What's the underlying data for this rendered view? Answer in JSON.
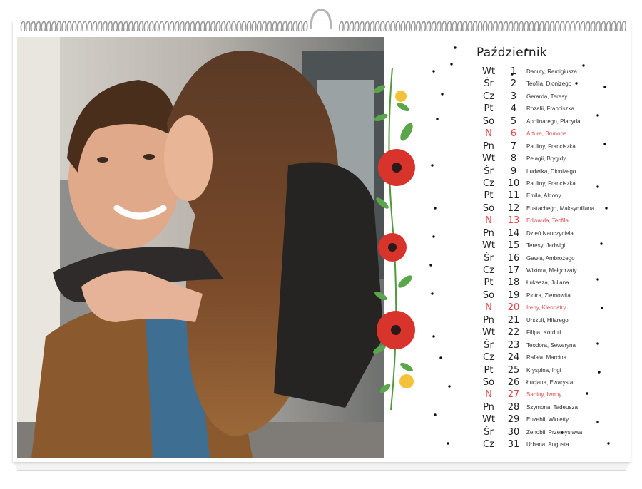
{
  "calendar": {
    "month": "Październik",
    "days": [
      {
        "dn": "Wt",
        "num": "1",
        "names": "Danuty, Remigiusza",
        "holiday": false
      },
      {
        "dn": "Śr",
        "num": "2",
        "names": "Teofila, Dionizego",
        "holiday": false
      },
      {
        "dn": "Cz",
        "num": "3",
        "names": "Gerarda, Teresy",
        "holiday": false
      },
      {
        "dn": "Pt",
        "num": "4",
        "names": "Rozalii, Franciszka",
        "holiday": false
      },
      {
        "dn": "So",
        "num": "5",
        "names": "Apolinarego, Placyda",
        "holiday": false
      },
      {
        "dn": "N",
        "num": "6",
        "names": "Artura, Brunona",
        "holiday": true
      },
      {
        "dn": "Pn",
        "num": "7",
        "names": "Pauliny, Franciszka",
        "holiday": false
      },
      {
        "dn": "Wt",
        "num": "8",
        "names": "Pelagii, Brygidy",
        "holiday": false
      },
      {
        "dn": "Śr",
        "num": "9",
        "names": "Ludwika, Dionizego",
        "holiday": false
      },
      {
        "dn": "Cz",
        "num": "10",
        "names": "Pauliny, Franciszka",
        "holiday": false
      },
      {
        "dn": "Pt",
        "num": "11",
        "names": "Emila, Aldony",
        "holiday": false
      },
      {
        "dn": "So",
        "num": "12",
        "names": "Eustachego, Maksymiliana",
        "holiday": false
      },
      {
        "dn": "N",
        "num": "13",
        "names": "Edwarda, Teofila",
        "holiday": true
      },
      {
        "dn": "Pn",
        "num": "14",
        "names": "Dzień Nauczyciela",
        "holiday": false
      },
      {
        "dn": "Wt",
        "num": "15",
        "names": "Teresy, Jadwigi",
        "holiday": false
      },
      {
        "dn": "Śr",
        "num": "16",
        "names": "Gawła, Ambrożego",
        "holiday": false
      },
      {
        "dn": "Cz",
        "num": "17",
        "names": "Wiktora, Małgorzaty",
        "holiday": false
      },
      {
        "dn": "Pt",
        "num": "18",
        "names": "Łukasza, Juliana",
        "holiday": false
      },
      {
        "dn": "So",
        "num": "19",
        "names": "Piotra, Ziemowita",
        "holiday": false
      },
      {
        "dn": "N",
        "num": "20",
        "names": "Ireny, Kleopatry",
        "holiday": true
      },
      {
        "dn": "Pn",
        "num": "21",
        "names": "Urszuli, Hilarego",
        "holiday": false
      },
      {
        "dn": "Wt",
        "num": "22",
        "names": "Filipa, Korduli",
        "holiday": false
      },
      {
        "dn": "Śr",
        "num": "23",
        "names": "Teodora, Seweryna",
        "holiday": false
      },
      {
        "dn": "Cz",
        "num": "24",
        "names": "Rafała, Marcina",
        "holiday": false
      },
      {
        "dn": "Pt",
        "num": "25",
        "names": "Kryspina, Ingi",
        "holiday": false
      },
      {
        "dn": "So",
        "num": "26",
        "names": "Łucjana, Ewarysta",
        "holiday": false
      },
      {
        "dn": "N",
        "num": "27",
        "names": "Sabiny, Iwony",
        "holiday": true
      },
      {
        "dn": "Pn",
        "num": "28",
        "names": "Szymona, Tadeusza",
        "holiday": false
      },
      {
        "dn": "Wt",
        "num": "29",
        "names": "Euzebii, Wioletty",
        "holiday": false
      },
      {
        "dn": "Śr",
        "num": "30",
        "names": "Zenobii, Przemysława",
        "holiday": false
      },
      {
        "dn": "Cz",
        "num": "31",
        "names": "Urbana, Augusta",
        "holiday": false
      }
    ]
  },
  "colors": {
    "holiday": "#e0474c",
    "text": "#222222",
    "poppy": "#d8342c",
    "leaf": "#4f9a3a"
  },
  "icons": {
    "binding": "wire-binding-icon",
    "hanger": "hanger-hook-icon",
    "flowers": "poppy-flower-garland-icon"
  }
}
